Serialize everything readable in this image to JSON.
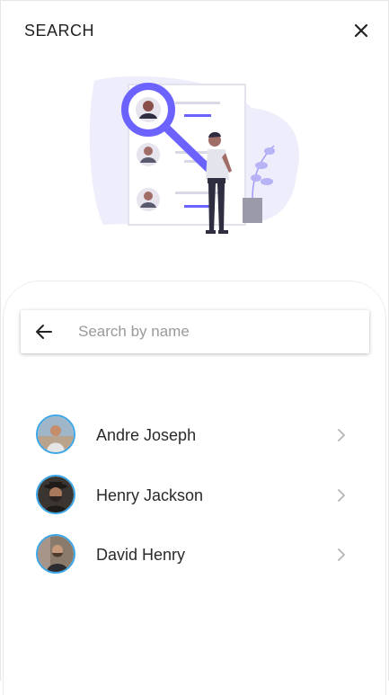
{
  "header": {
    "title": "SEARCH",
    "close_icon": "close-icon"
  },
  "illustration": {
    "name": "person-searching-profiles-illustration",
    "accent": "#6c63ff"
  },
  "search": {
    "placeholder": "Search by name",
    "value": "",
    "back_icon": "arrow-left-icon"
  },
  "results": [
    {
      "name": "Andre Joseph",
      "icon": "chevron-right-icon"
    },
    {
      "name": "Henry Jackson",
      "icon": "chevron-right-icon"
    },
    {
      "name": "David Henry",
      "icon": "chevron-right-icon"
    }
  ],
  "colors": {
    "accent": "#6c63ff",
    "avatar_ring": "#3aa6e8",
    "blob": "#eeedfb"
  }
}
